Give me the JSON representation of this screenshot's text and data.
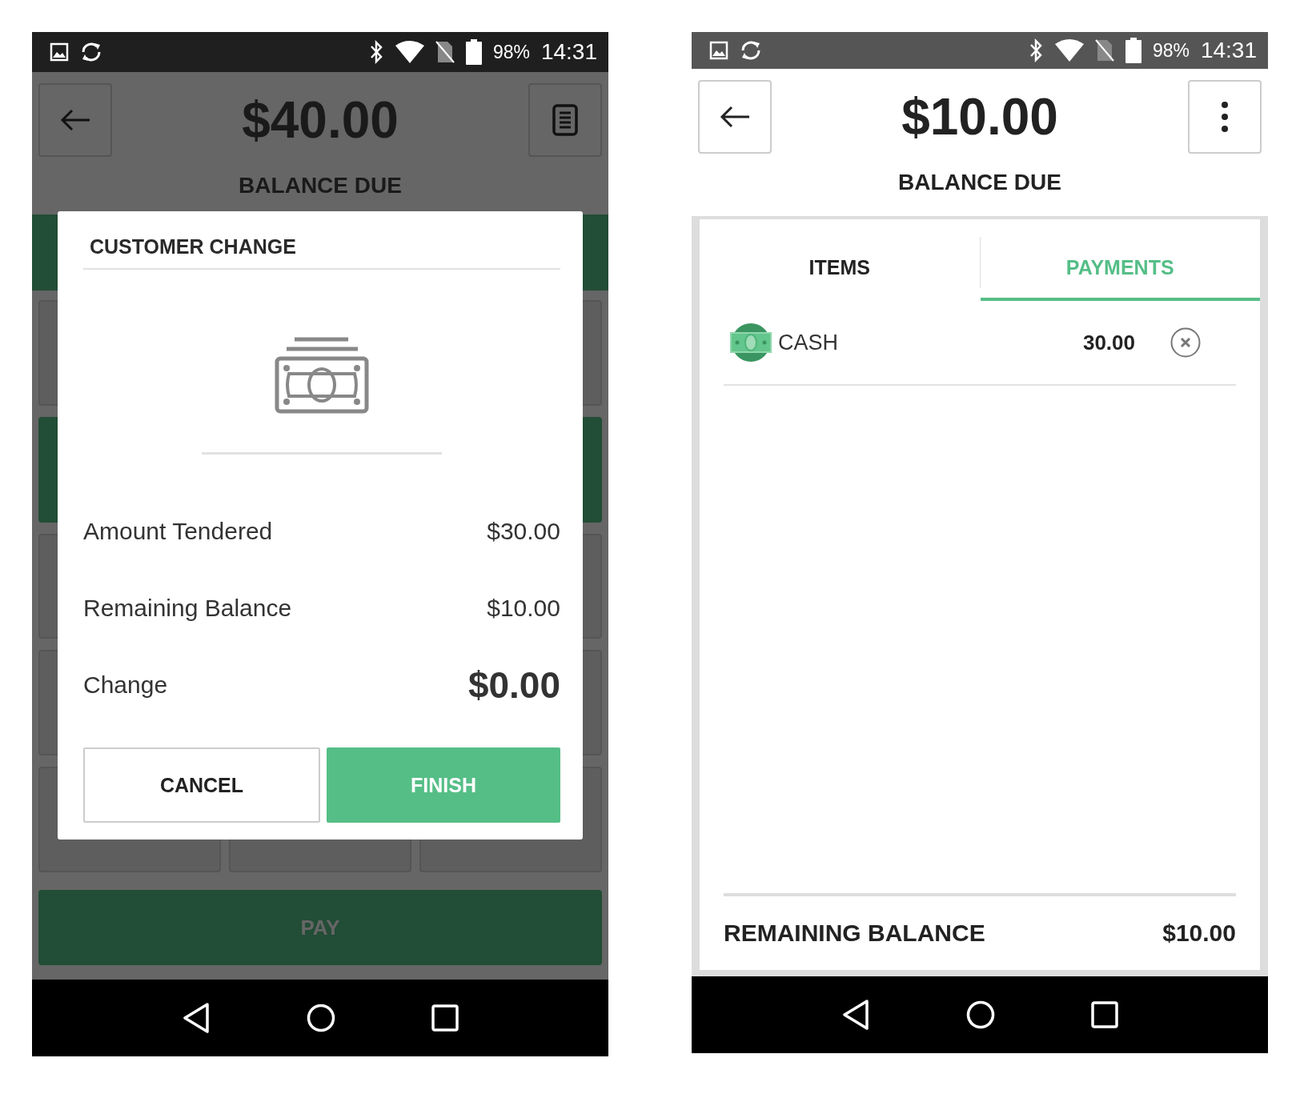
{
  "left_screen": {
    "status_bar": {
      "battery": "98%",
      "time": "14:31"
    },
    "header": {
      "amount": "$40.00",
      "label": "BALANCE DUE",
      "right_button": {
        "kind": "receipt"
      }
    },
    "pay_button": "PAY",
    "dialog": {
      "title": "CUSTOMER CHANGE",
      "rows": [
        {
          "label": "Amount Tendered",
          "value": "$30.00",
          "emphasis": false
        },
        {
          "label": "Remaining Balance",
          "value": "$10.00",
          "emphasis": false
        },
        {
          "label": "Change",
          "value": "$0.00",
          "emphasis": true
        }
      ],
      "buttons": [
        {
          "label": "CANCEL",
          "kind": "secondary"
        },
        {
          "label": "FINISH",
          "kind": "primary"
        }
      ]
    }
  },
  "right_screen": {
    "status_bar": {
      "battery": "98%",
      "time": "14:31"
    },
    "header": {
      "amount": "$10.00",
      "label": "BALANCE DUE",
      "right_button": {
        "kind": "menu"
      }
    },
    "tabs": [
      {
        "label": "ITEMS",
        "selected": false
      },
      {
        "label": "PAYMENTS",
        "selected": true
      }
    ],
    "payments": [
      {
        "method": "CASH",
        "amount": "30.00"
      }
    ],
    "footer": {
      "label": "REMAINING BALANCE",
      "value": "$10.00"
    }
  }
}
